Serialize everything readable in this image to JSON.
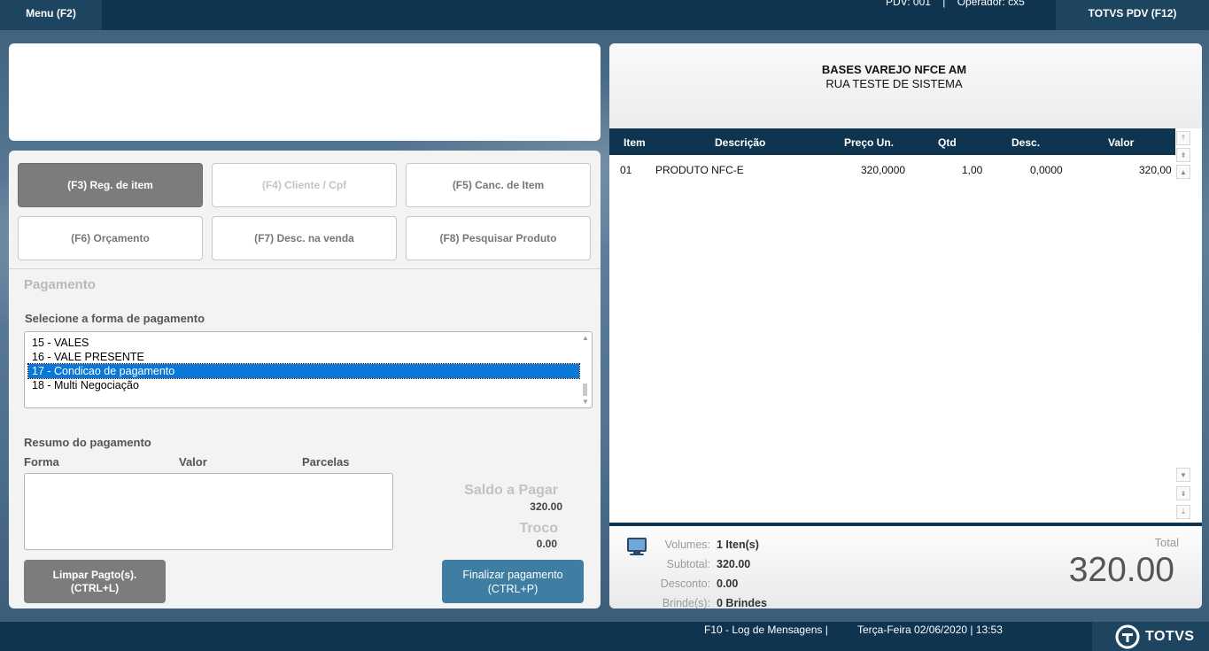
{
  "topbar": {
    "menu_label": "Menu (F2)",
    "pdv_info": "PDV: 001    |    Operador: cx5",
    "totvs_pdv_label": "TOTVS PDV (F12)"
  },
  "function_keys": {
    "f3": "(F3) Reg. de item",
    "f4": "(F4) Cliente / Cpf",
    "f5": "(F5) Canc. de Item",
    "f6": "(F6) Orçamento",
    "f7": "(F7) Desc. na venda",
    "f8": "(F8) Pesquisar Produto"
  },
  "payment": {
    "title": "Pagamento",
    "select_label": "Selecione a forma de pagamento",
    "options": [
      "15 - VALES",
      "16 - VALE PRESENTE",
      "17 - Condicao de pagamento",
      "18 - Multi Negociação"
    ],
    "selected_index": 2,
    "summary_title": "Resumo do pagamento",
    "summary_columns": [
      "Forma",
      "Valor",
      "Parcelas"
    ],
    "saldo_label": "Saldo a Pagar",
    "saldo_value": "320.00",
    "troco_label": "Troco",
    "troco_value": "0.00",
    "clear_button": [
      "Limpar Pagto(s).",
      "(CTRL+L)"
    ],
    "finish_button": [
      "Finalizar pagamento",
      "(CTRL+P)"
    ]
  },
  "receipt": {
    "store_name": "BASES VAREJO NFCE AM",
    "store_address": "RUA TESTE DE SISTEMA",
    "columns": [
      "Item",
      "Descrição",
      "Preço Un.",
      "Qtd",
      "Desc.",
      "Valor"
    ],
    "rows": [
      {
        "item": "01",
        "descricao": "PRODUTO NFC-E",
        "preco": "320,0000",
        "qtd": "1,00",
        "desc": "0,0000",
        "valor": "320,00"
      }
    ]
  },
  "summary": {
    "volumes_label": "Volumes:",
    "volumes_value": "1 Iten(s)",
    "subtotal_label": "Subtotal:",
    "subtotal_value": "320.00",
    "desconto_label": "Desconto:",
    "desconto_value": "0.00",
    "brindes_label": "Brinde(s):",
    "brindes_value": "0 Brindes",
    "total_label": "Total",
    "total_value": "320.00"
  },
  "statusbar": {
    "log_messages": "F10 - Log de Mensagens |",
    "datetime": "Terça-Feira 02/06/2020 | 13:53",
    "brand": "TOTVS"
  }
}
